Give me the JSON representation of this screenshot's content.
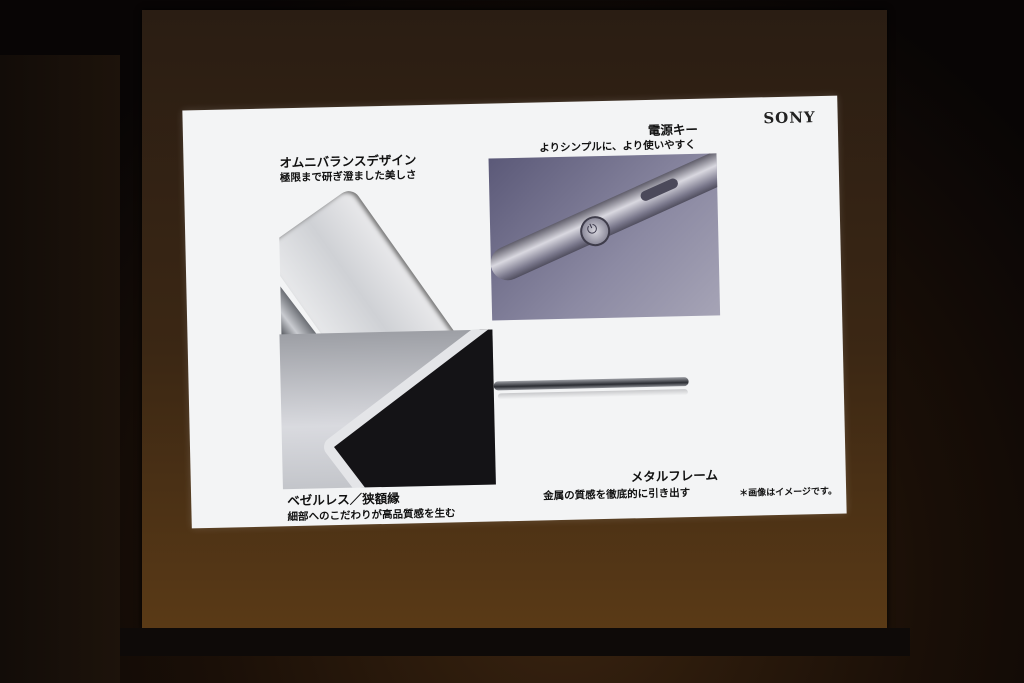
{
  "slide": {
    "logo": "SONY",
    "sections": {
      "top_left": {
        "title": "オムニバランスデザイン",
        "subtitle": "極限まで研ぎ澄ました美しさ"
      },
      "top_right": {
        "title": "電源キー",
        "subtitle": "よりシンプルに、より使いやすく"
      },
      "bottom_left": {
        "title": "ベゼルレス／狭額縁",
        "subtitle": "細部へのこだわりが高品質感を生む"
      },
      "bottom_right": {
        "title": "メタルフレーム",
        "subtitle": "金属の質感を徹底的に引き出す"
      }
    },
    "note": "＊画像はイメージです。"
  },
  "icons": [
    "power-icon"
  ],
  "colors": {
    "slide_bg": "#f3f4f5",
    "room_dark": "#0c0806",
    "screen_brown": "#3b2714"
  }
}
